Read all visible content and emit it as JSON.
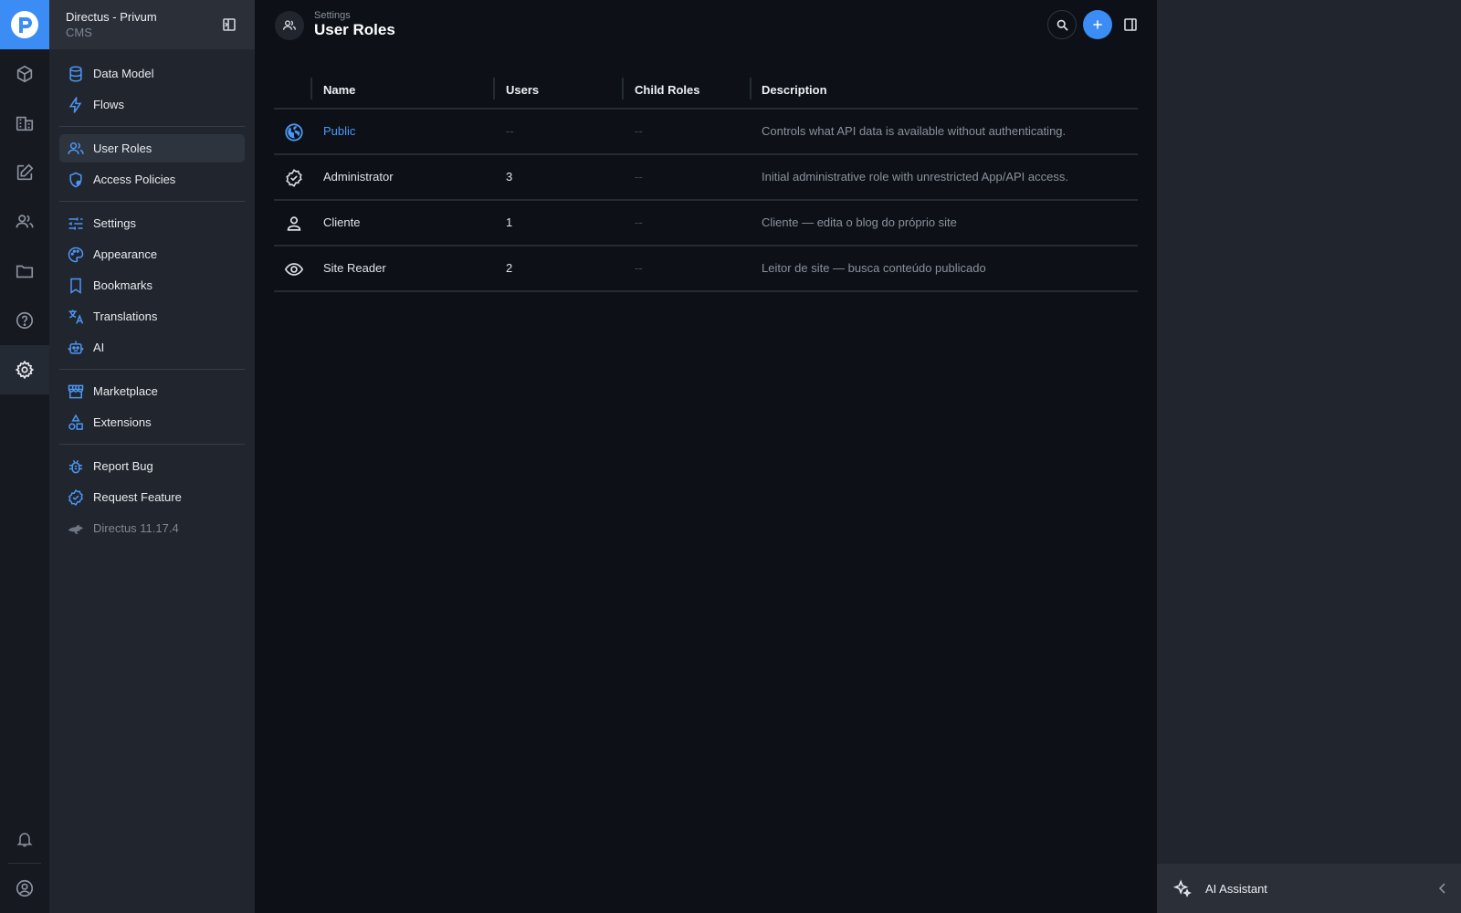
{
  "project": {
    "name": "Directus - Privum",
    "subtitle": "CMS"
  },
  "modules": [
    {
      "name": "content",
      "icon": "cube-icon"
    },
    {
      "name": "pages",
      "icon": "building-icon"
    },
    {
      "name": "edit",
      "icon": "edit-icon"
    },
    {
      "name": "users",
      "icon": "users-icon"
    },
    {
      "name": "files",
      "icon": "folder-icon"
    },
    {
      "name": "help",
      "icon": "help-icon"
    },
    {
      "name": "settings",
      "icon": "gear-icon",
      "active": true
    },
    {
      "name": "notifications",
      "icon": "bell-icon"
    },
    {
      "name": "account",
      "icon": "account-icon"
    }
  ],
  "nav": {
    "items": [
      {
        "label": "Data Model",
        "icon": "database-icon"
      },
      {
        "label": "Flows",
        "icon": "bolt-icon"
      },
      {
        "label": "User Roles",
        "icon": "group-icon",
        "active": true
      },
      {
        "label": "Access Policies",
        "icon": "shield-icon"
      },
      {
        "label": "Settings",
        "icon": "tune-icon"
      },
      {
        "label": "Appearance",
        "icon": "palette-icon"
      },
      {
        "label": "Bookmarks",
        "icon": "bookmark-icon"
      },
      {
        "label": "Translations",
        "icon": "translate-icon"
      },
      {
        "label": "AI",
        "icon": "robot-icon"
      },
      {
        "label": "Marketplace",
        "icon": "storefront-icon"
      },
      {
        "label": "Extensions",
        "icon": "shapes-icon"
      },
      {
        "label": "Report Bug",
        "icon": "bug-icon"
      },
      {
        "label": "Request Feature",
        "icon": "verified-icon"
      },
      {
        "label": "Directus 11.17.4",
        "icon": "directus-rabbit-icon"
      }
    ]
  },
  "header": {
    "breadcrumb": "Settings",
    "title": "User Roles"
  },
  "table": {
    "columns": [
      "Name",
      "Users",
      "Child Roles",
      "Description"
    ],
    "rows": [
      {
        "icon": "public-globe-icon",
        "name": "Public",
        "users": "--",
        "child_roles": "--",
        "description": "Controls what API data is available without authenticating."
      },
      {
        "icon": "verified-badge-icon",
        "name": "Administrator",
        "users": "3",
        "child_roles": "--",
        "description": "Initial administrative role with unrestricted App/API access."
      },
      {
        "icon": "person-icon",
        "name": "Cliente",
        "users": "1",
        "child_roles": "--",
        "description": "Cliente — edita o blog do próprio site"
      },
      {
        "icon": "eye-icon",
        "name": "Site Reader",
        "users": "2",
        "child_roles": "--",
        "description": "Leitor de site — busca conteúdo publicado"
      }
    ]
  },
  "ai_panel": {
    "label": "AI Assistant"
  },
  "colors": {
    "accent": "#3b8cf4",
    "background": "#0d1117",
    "sidebar": "#21252d"
  }
}
